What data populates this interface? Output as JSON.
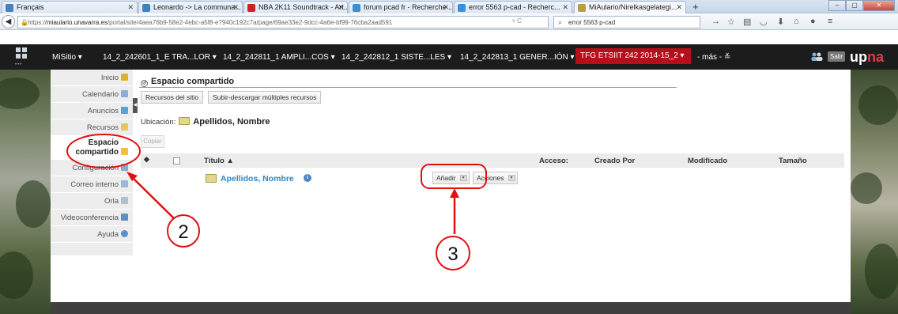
{
  "browser": {
    "tabs": [
      {
        "label": "Français",
        "color": "#4a7fc0"
      },
      {
        "label": "Leonardo -> La communa...",
        "color": "#3a84c4"
      },
      {
        "label": "NBA 2K11 Soundtrack - Art...",
        "color": "#cc2222"
      },
      {
        "label": "forum pcad fr - Recherche ...",
        "color": "#3b8fd4"
      },
      {
        "label": "error 5563 p-cad - Recherc...",
        "color": "#3b8fd4"
      },
      {
        "label": "MiAulario/Nirelkasgelategi...",
        "color": "#b5a040"
      }
    ],
    "url_prefix": "https://",
    "url_domain": "miaulario.unavarra.es",
    "url_path": "/portal/site/4aea76b9-58e2-4ebc-a5f8-e7940c192c7a/page/69ae33e2-9dcc-4a6e-bf99-76cba2aad591",
    "search_value": "error 5563 p-cad"
  },
  "sitenav": {
    "items": [
      "MiSitio ▾",
      "14_2_242601_1_E TRA...LOR ▾",
      "14_2_242811_1 AMPLI...COS ▾",
      "14_2_242812_1 SISTE...LES ▾",
      "14_2_242813_1 GENER...IÓN ▾"
    ],
    "active_site": "TFG ETSIIT 242 2014-15_2 ▾",
    "more": "- más - ≚",
    "salir": "Salir",
    "logo_main": "up",
    "logo_accent": "na"
  },
  "tools": [
    {
      "label": "Inicio",
      "icon": "home-icon",
      "color": "#e0b030"
    },
    {
      "label": "Calendario",
      "icon": "calendar-icon",
      "color": "#8ab0d8"
    },
    {
      "label": "Anuncios",
      "icon": "announcements-icon",
      "color": "#5aa0d8"
    },
    {
      "label": "Recursos",
      "icon": "resources-icon",
      "color": "#e2c860"
    },
    {
      "label": "Espacio compartido",
      "icon": "shared-folder-icon",
      "color": "#f0c040"
    },
    {
      "label": "Configuración",
      "icon": "settings-icon",
      "color": "#8aa8c8"
    },
    {
      "label": "Correo interno",
      "icon": "mail-icon",
      "color": "#9ab8d8"
    },
    {
      "label": "Orla",
      "icon": "group-icon",
      "color": "#b0c0d0"
    },
    {
      "label": "Videoconferencia",
      "icon": "video-icon",
      "color": "#6090c0"
    },
    {
      "label": "Ayuda",
      "icon": "help-icon",
      "color": "#5a90d0"
    }
  ],
  "content": {
    "title": "Espacio compartido",
    "buttons": [
      "Recursos del sitio",
      "Subir-descargar múltiples recursos"
    ],
    "location_label": "Ubicación:",
    "location_value": "Apellidos, Nombre",
    "copy_button": "Copiar",
    "columns": {
      "title": "Título ▲",
      "access": "Acceso:",
      "created_by": "Creado Por",
      "modified": "Modificado",
      "size": "Tamaño"
    },
    "row": {
      "name": "Apellidos, Nombre",
      "add": "Añadir",
      "actions": "Acciones"
    }
  },
  "annotations": {
    "label_2": "2",
    "label_3": "3",
    "color": "#e01010"
  }
}
